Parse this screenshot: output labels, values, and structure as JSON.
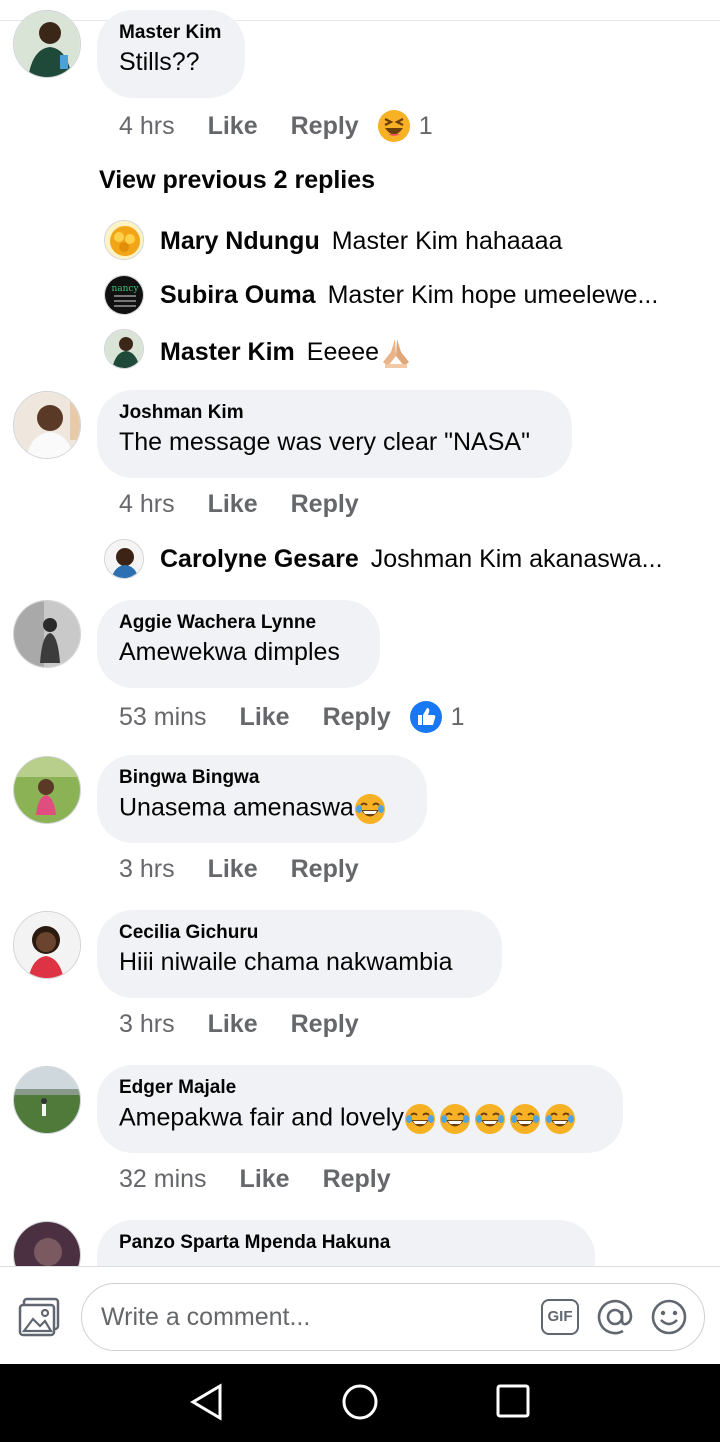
{
  "comments": [
    {
      "author": "Master Kim",
      "text": "Stills??",
      "time": "4 hrs",
      "like_label": "Like",
      "reply_label": "Reply",
      "reaction": {
        "icon": "laughing-emoji-icon",
        "count": "1"
      },
      "view_previous": "View previous 2 replies",
      "replies": [
        {
          "author": "Mary Ndungu",
          "text": "Master Kim hahaaaa"
        },
        {
          "author": "Subira Ouma",
          "text": "Master Kim hope umeelewe..."
        },
        {
          "author": "Master Kim",
          "text": "Eeeee",
          "emoji": "folded-hands-emoji-icon"
        }
      ]
    },
    {
      "author": "Joshman Kim",
      "text": "The message was very clear \"NASA\"",
      "time": "4 hrs",
      "like_label": "Like",
      "reply_label": "Reply",
      "replies": [
        {
          "author": "Carolyne Gesare",
          "text": "Joshman Kim akanaswa..."
        }
      ]
    },
    {
      "author": "Aggie Wachera Lynne",
      "text": "Amewekwa dimples",
      "time": "53 mins",
      "like_label": "Like",
      "reply_label": "Reply",
      "reaction": {
        "icon": "like-thumb-icon",
        "count": "1"
      }
    },
    {
      "author": "Bingwa Bingwa",
      "text": "Unasema amenaswa",
      "emoji": "tears-of-joy-emoji-icon",
      "time": "3 hrs",
      "like_label": "Like",
      "reply_label": "Reply"
    },
    {
      "author": "Cecilia Gichuru",
      "text": "Hiii niwaile chama nakwambia",
      "time": "3 hrs",
      "like_label": "Like",
      "reply_label": "Reply"
    },
    {
      "author": "Edger Majale",
      "text": "Amepakwa fair and lovely",
      "emoji": "tears-of-joy-emoji-icon",
      "time": "32 mins",
      "like_label": "Like",
      "reply_label": "Reply"
    },
    {
      "author": "Panzo Sparta Mpenda Hakuna"
    }
  ],
  "composer": {
    "placeholder": "Write a comment...",
    "gif_label": "GIF"
  },
  "colors": {
    "bubble_bg": "#f0f2f5",
    "meta_text": "#65676b",
    "like_blue": "#1877f2",
    "emoji_yellow": "#f7b125"
  }
}
